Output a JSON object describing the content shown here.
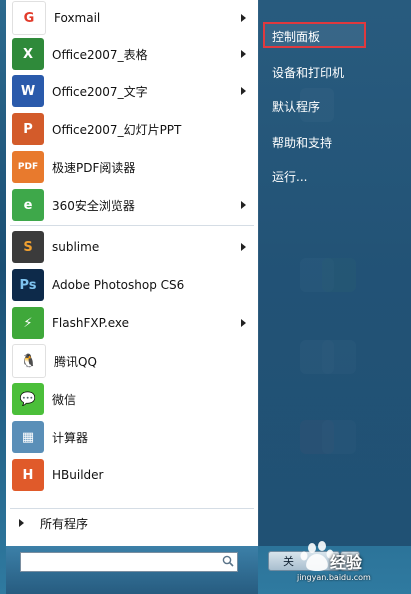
{
  "programs": [
    {
      "label": "Foxmail",
      "icon": "foxmail-icon",
      "arrow": true
    },
    {
      "label": "Office2007_表格",
      "icon": "excel-icon",
      "arrow": true
    },
    {
      "label": "Office2007_文字",
      "icon": "word-icon",
      "arrow": true
    },
    {
      "label": "Office2007_幻灯片PPT",
      "icon": "powerpoint-icon",
      "arrow": false
    },
    {
      "label": "极速PDF阅读器",
      "icon": "pdf-reader-icon",
      "arrow": false
    },
    {
      "label": "360安全浏览器",
      "icon": "360-browser-icon",
      "arrow": true
    },
    {
      "label": "sublime",
      "icon": "sublime-icon",
      "arrow": true
    },
    {
      "label": "Adobe Photoshop CS6",
      "icon": "photoshop-icon",
      "arrow": false
    },
    {
      "label": "FlashFXP.exe",
      "icon": "flashfxp-icon",
      "arrow": true
    },
    {
      "label": "腾讯QQ",
      "icon": "qq-icon",
      "arrow": false
    },
    {
      "label": "微信",
      "icon": "wechat-icon",
      "arrow": false
    },
    {
      "label": "计算器",
      "icon": "calculator-icon",
      "arrow": false
    },
    {
      "label": "HBuilder",
      "icon": "hbuilder-icon",
      "arrow": false
    }
  ],
  "all_programs": "所有程序",
  "right_links": [
    "控制面板",
    "设备和打印机",
    "默认程序",
    "帮助和支持",
    "运行..."
  ],
  "shutdown_label": "关",
  "watermark": {
    "text": "经验",
    "url": "jingyan.baidu.com"
  },
  "colors": {
    "highlight_box": "#e0393e",
    "panel_bg": "#ffffff"
  }
}
